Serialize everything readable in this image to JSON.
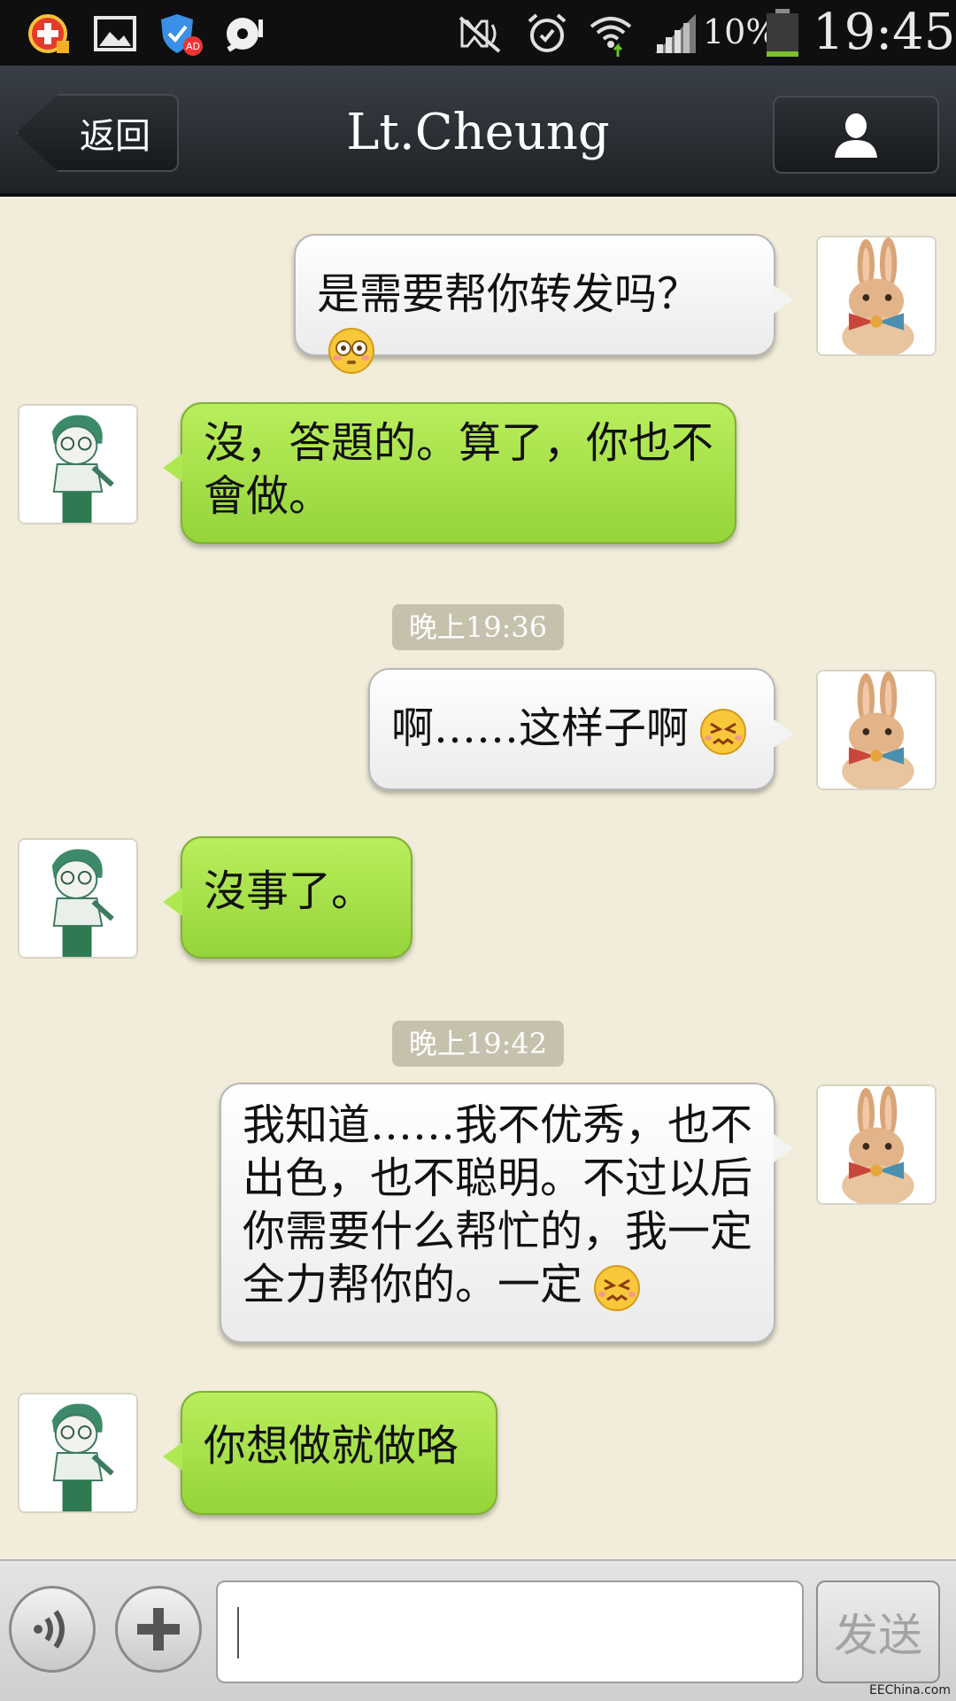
{
  "status_bar": {
    "icons": [
      "plus-badge-icon",
      "gallery-icon",
      "shield-ad-icon",
      "notification-icon",
      "mute-icon",
      "alarm-icon",
      "wifi-icon",
      "signal-icon",
      "battery-icon"
    ],
    "battery": "10%",
    "time": "19:45"
  },
  "header": {
    "back_label": "返回",
    "title": "Lt.Cheung",
    "profile_icon": "person-icon"
  },
  "messages": [
    {
      "side": "out",
      "text": "是需要帮你转发吗？",
      "emoji": "flushed-face"
    },
    {
      "side": "in",
      "text": "沒，答題的。算了，你也不會做。"
    },
    {
      "side": "time",
      "text": "晚上19:36"
    },
    {
      "side": "out",
      "text": "啊……这样子啊",
      "emoji": "persevering-face"
    },
    {
      "side": "in",
      "text": "沒事了。"
    },
    {
      "side": "time",
      "text": "晚上19:42"
    },
    {
      "side": "out",
      "text": "我知道……我不优秀，也不出色，也不聪明。不过以后你需要什么帮忙的，我一定全力帮你的。一定",
      "emoji": "persevering-face"
    },
    {
      "side": "in",
      "text": "你想做就做咯"
    }
  ],
  "input_bar": {
    "voice_icon": "voice-icon",
    "plus_icon": "plus-icon",
    "text_value": "",
    "send_label": "发送"
  },
  "watermark": "EEChina.com",
  "colors": {
    "chat_background": "#f1edda",
    "incoming_bubble": "#a8e24c",
    "outgoing_bubble": "#f3f3f3",
    "titlebar": "#2a2f34"
  }
}
